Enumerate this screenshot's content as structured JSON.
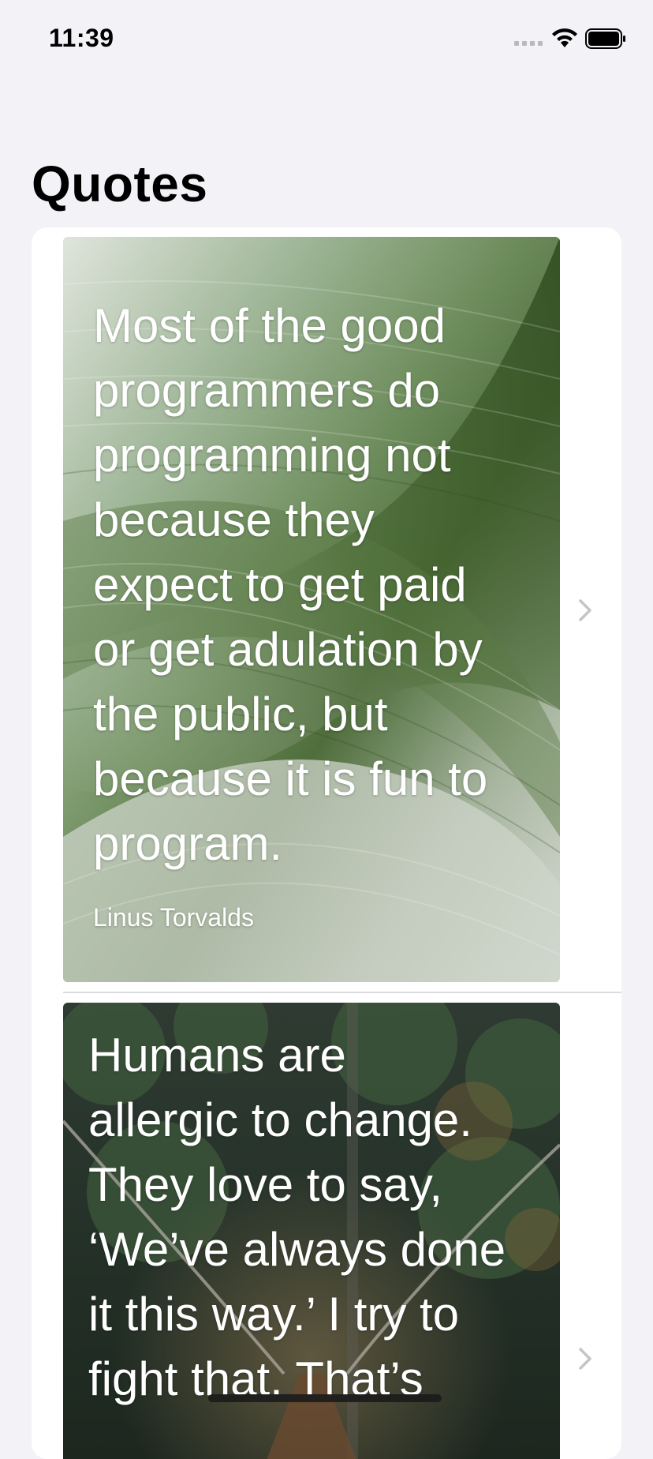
{
  "status_bar": {
    "time": "11:39",
    "icons": [
      "signal-icon",
      "wifi-icon",
      "battery-icon"
    ]
  },
  "header": {
    "title": "Quotes"
  },
  "quotes": [
    {
      "text": "Most of the good\nprogrammers do\nprogramming not\nbecause they\nexpect to get paid\nor get adulation by\nthe public, but\nbecause it is fun to\nprogram.",
      "author": "Linus Torvalds",
      "background": "green-leaf-photo",
      "accessory": "chevron-right-icon"
    },
    {
      "text": "Humans are\nallergic to change.\nThey love to say,\n‘We’ve always done\nit this way.’ I try to\nfight that. That’s",
      "author": "",
      "background": "forest-bridge-photo",
      "accessory": "chevron-right-icon"
    }
  ],
  "colors": {
    "background": "#f2f2f7",
    "card": "#ffffff",
    "chevron": "#c4c4c9",
    "separator": "#dcdce0"
  }
}
